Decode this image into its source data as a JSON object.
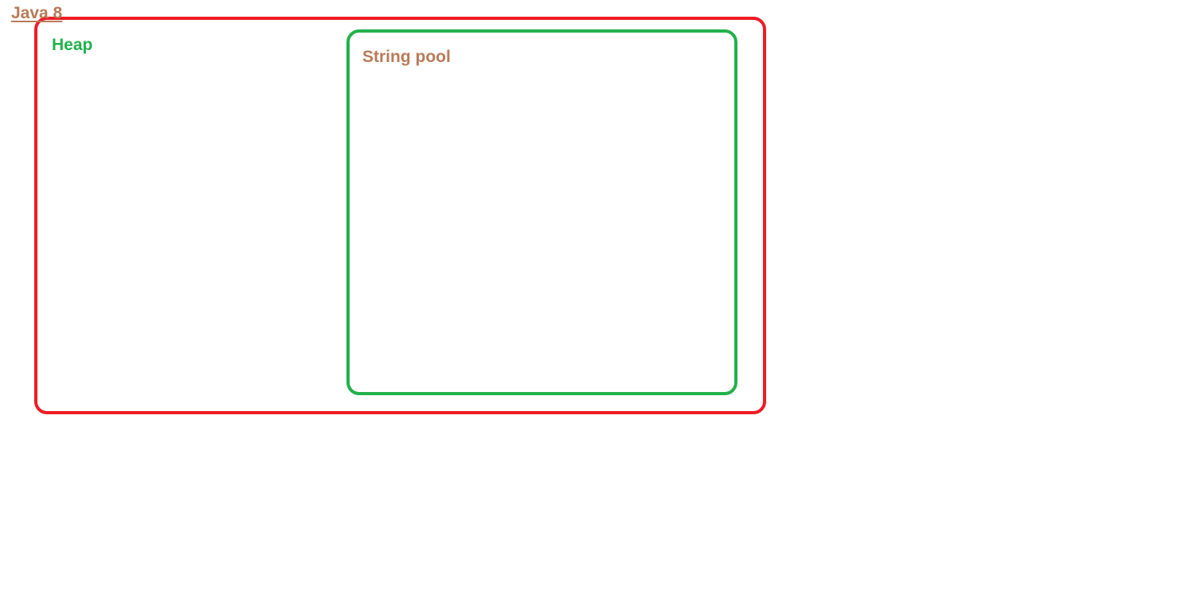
{
  "diagram": {
    "title": "Java 8",
    "regions": {
      "heap": {
        "label": "Heap"
      },
      "string_pool": {
        "label": "String pool"
      }
    }
  },
  "colors": {
    "title_text": "#b97a57",
    "heap_border": "#ed1c24",
    "heap_label": "#22b14c",
    "pool_border": "#22b14c",
    "pool_label": "#b97a57",
    "background": "#ffffff"
  }
}
